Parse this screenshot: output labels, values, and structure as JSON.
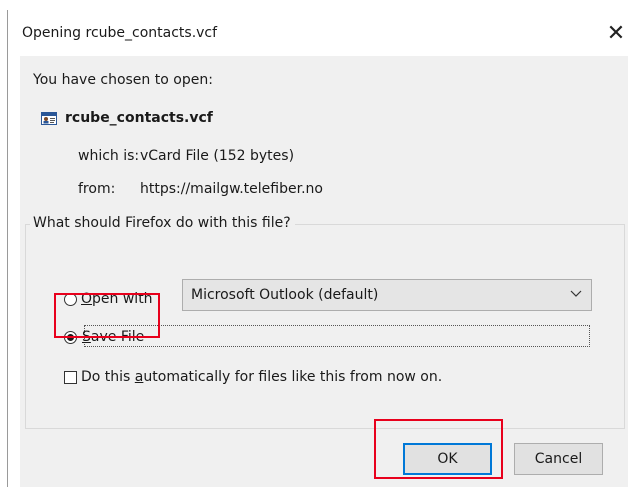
{
  "dialog": {
    "title": "Opening rcube_contacts.vcf",
    "close_glyph": "✕"
  },
  "info": {
    "chosen_text": "You have chosen to open:",
    "file_icon": "vcard-icon",
    "file_name": "rcube_contacts.vcf",
    "which_label": "which is:",
    "which_value": "vCard File (152 bytes)",
    "from_label": "from:",
    "from_value": "https://mailgw.telefiber.no"
  },
  "action_group": {
    "legend": "What should Firefox do with this file?",
    "open_with": {
      "accel": "O",
      "rest": "pen with",
      "selected": false
    },
    "app_select": {
      "value": "Microsoft Outlook (default)"
    },
    "save_file": {
      "accel": "S",
      "rest": "ave File",
      "selected": true
    },
    "auto_checkbox": {
      "before": "Do this ",
      "accel": "a",
      "after": "utomatically for files like this from now on.",
      "checked": false
    }
  },
  "buttons": {
    "ok_label": "OK",
    "cancel_label": "Cancel"
  },
  "colors": {
    "highlight": "#e8001c",
    "default_button_border": "#0078d7",
    "client_bg": "#f0f0f0"
  }
}
